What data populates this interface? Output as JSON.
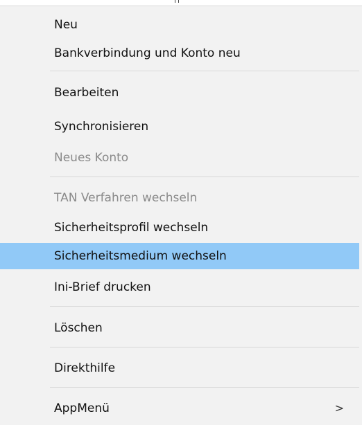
{
  "menu": {
    "items": [
      {
        "label": "Neu"
      },
      {
        "label": "Bankverbindung und Konto neu"
      },
      {
        "label": "Bearbeiten"
      },
      {
        "label": "Synchronisieren"
      },
      {
        "label": "Neues Konto"
      },
      {
        "label": "TAN Verfahren wechseln"
      },
      {
        "label": "Sicherheitsprofil wechseln"
      },
      {
        "label": "Sicherheitsmedium wechseln"
      },
      {
        "label": "Ini-Brief drucken"
      },
      {
        "label": "Löschen"
      },
      {
        "label": "Direkthilfe"
      },
      {
        "label": "AppMenü",
        "submenu_indicator": ">"
      }
    ]
  }
}
